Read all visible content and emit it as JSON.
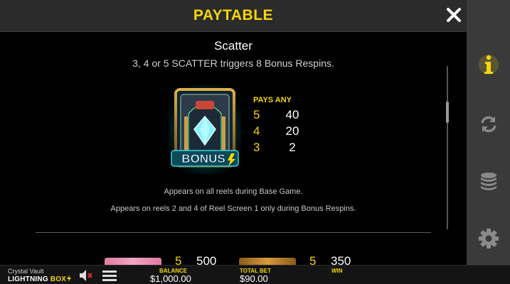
{
  "header": {
    "title": "PAYTABLE"
  },
  "side_panel": {
    "icons": [
      "info-icon",
      "autoplay-icon",
      "coins-icon",
      "settings-icon"
    ],
    "active": "info-icon"
  },
  "section": {
    "title": "Scatter",
    "description": "3, 4 or 5 SCATTER triggers 8 Bonus Respins.",
    "symbol_label": "BONUS"
  },
  "pays": {
    "header": "PAYS ANY",
    "rows": [
      {
        "count": "5",
        "value": "40"
      },
      {
        "count": "4",
        "value": "20"
      },
      {
        "count": "3",
        "value": "2"
      }
    ]
  },
  "notes": [
    "Appears on all reels during Base Game.",
    "Appears on reels 2 and 4 of Reel Screen 1 only during Bonus Respins."
  ],
  "next_row": [
    {
      "count": "5",
      "value": "500"
    },
    {
      "count": "5",
      "value": "350"
    }
  ],
  "footer": {
    "game_name": "Crystal Vault",
    "brand_left": "LIGHTNING ",
    "brand_right": "BOX",
    "balance_label": "BALANCE",
    "balance_value": "$1,000.00",
    "bet_label": "TOTAL BET",
    "bet_value": "$90.00",
    "win_label": "WIN",
    "win_value": ""
  },
  "colors": {
    "accent": "#f5d60a",
    "panel": "#3a3a3a",
    "header": "#2b2b2b",
    "background": "#000000"
  }
}
